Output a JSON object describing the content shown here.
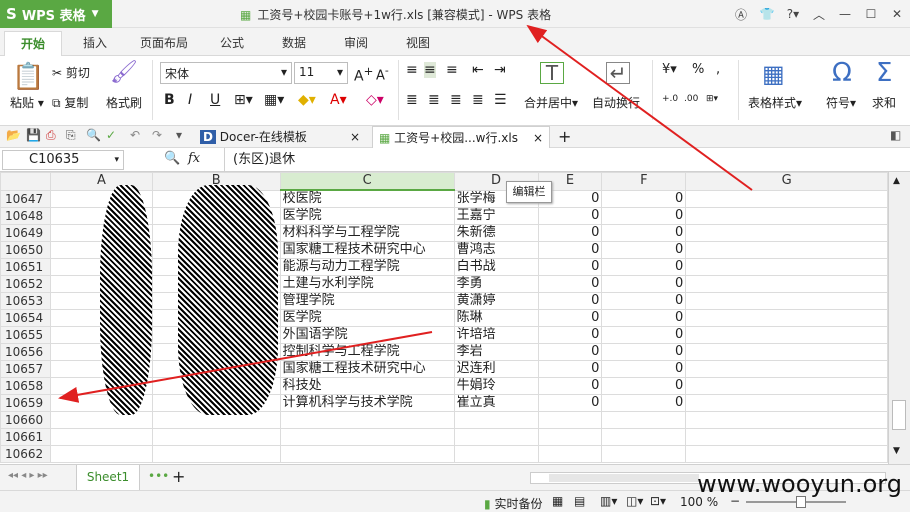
{
  "app": {
    "name": "WPS 表格",
    "logo": "S"
  },
  "title": "工资号+校园卡账号+1w行.xls [兼容模式] - WPS 表格",
  "tabs": [
    "开始",
    "插入",
    "页面布局",
    "公式",
    "数据",
    "审阅",
    "视图"
  ],
  "ribbon": {
    "paste": "粘贴",
    "cut": "剪切",
    "copy": "复制",
    "format_painter": "格式刷",
    "font": "宋体",
    "size": "11",
    "merge": "合并居中",
    "wrap": "自动换行",
    "table_style": "表格样式",
    "symbol": "符号",
    "sum": "求和"
  },
  "doc_tabs": [
    {
      "label": "Docer-在线模板"
    },
    {
      "label": "工资号+校园...w行.xls"
    }
  ],
  "formula_bar": {
    "cell": "C10635",
    "fx": "fx",
    "value": "(东区)退休"
  },
  "tooltip": "编辑栏",
  "columns": [
    "A",
    "B",
    "C",
    "D",
    "E",
    "F",
    "G"
  ],
  "rows": [
    {
      "n": "10647",
      "c": "校医院",
      "d": "张学梅",
      "e": "0",
      "f": "0"
    },
    {
      "n": "10648",
      "c": "医学院",
      "d": "王嘉宁",
      "e": "0",
      "f": "0"
    },
    {
      "n": "10649",
      "c": "材料科学与工程学院",
      "d": "朱新德",
      "e": "0",
      "f": "0"
    },
    {
      "n": "10650",
      "c": "国家糖工程技术研究中心",
      "d": "曹鸿志",
      "e": "0",
      "f": "0"
    },
    {
      "n": "10651",
      "c": "能源与动力工程学院",
      "d": "白书战",
      "e": "0",
      "f": "0"
    },
    {
      "n": "10652",
      "c": "土建与水利学院",
      "d": "李勇",
      "e": "0",
      "f": "0"
    },
    {
      "n": "10653",
      "c": "管理学院",
      "d": "黄潇婷",
      "e": "0",
      "f": "0"
    },
    {
      "n": "10654",
      "c": "医学院",
      "d": "陈琳",
      "e": "0",
      "f": "0"
    },
    {
      "n": "10655",
      "c": "外国语学院",
      "d": "许培培",
      "e": "0",
      "f": "0"
    },
    {
      "n": "10656",
      "c": "控制科学与工程学院",
      "d": "李岩",
      "e": "0",
      "f": "0"
    },
    {
      "n": "10657",
      "c": "国家糖工程技术研究中心",
      "d": "迟连利",
      "e": "0",
      "f": "0"
    },
    {
      "n": "10658",
      "c": "科技处",
      "d": "牛娟玲",
      "e": "0",
      "f": "0"
    },
    {
      "n": "10659",
      "c": "计算机科学与技术学院",
      "d": "崔立真",
      "e": "0",
      "f": "0"
    },
    {
      "n": "10660",
      "c": "",
      "d": "",
      "e": "",
      "f": ""
    },
    {
      "n": "10661",
      "c": "",
      "d": "",
      "e": "",
      "f": ""
    },
    {
      "n": "10662",
      "c": "",
      "d": "",
      "e": "",
      "f": ""
    }
  ],
  "sheet": "Sheet1",
  "status": {
    "backup": "实时备份",
    "zoom": "100 %"
  },
  "watermark": "www.wooyun.org"
}
